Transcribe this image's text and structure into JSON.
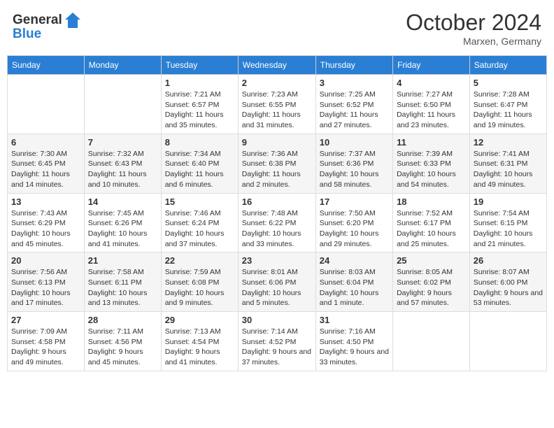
{
  "header": {
    "logo_line1": "General",
    "logo_line2": "Blue",
    "month": "October 2024",
    "location": "Marxen, Germany"
  },
  "weekdays": [
    "Sunday",
    "Monday",
    "Tuesday",
    "Wednesday",
    "Thursday",
    "Friday",
    "Saturday"
  ],
  "weeks": [
    [
      {
        "day": "",
        "sunrise": "",
        "sunset": "",
        "daylight": ""
      },
      {
        "day": "",
        "sunrise": "",
        "sunset": "",
        "daylight": ""
      },
      {
        "day": "1",
        "sunrise": "Sunrise: 7:21 AM",
        "sunset": "Sunset: 6:57 PM",
        "daylight": "Daylight: 11 hours and 35 minutes."
      },
      {
        "day": "2",
        "sunrise": "Sunrise: 7:23 AM",
        "sunset": "Sunset: 6:55 PM",
        "daylight": "Daylight: 11 hours and 31 minutes."
      },
      {
        "day": "3",
        "sunrise": "Sunrise: 7:25 AM",
        "sunset": "Sunset: 6:52 PM",
        "daylight": "Daylight: 11 hours and 27 minutes."
      },
      {
        "day": "4",
        "sunrise": "Sunrise: 7:27 AM",
        "sunset": "Sunset: 6:50 PM",
        "daylight": "Daylight: 11 hours and 23 minutes."
      },
      {
        "day": "5",
        "sunrise": "Sunrise: 7:28 AM",
        "sunset": "Sunset: 6:47 PM",
        "daylight": "Daylight: 11 hours and 19 minutes."
      }
    ],
    [
      {
        "day": "6",
        "sunrise": "Sunrise: 7:30 AM",
        "sunset": "Sunset: 6:45 PM",
        "daylight": "Daylight: 11 hours and 14 minutes."
      },
      {
        "day": "7",
        "sunrise": "Sunrise: 7:32 AM",
        "sunset": "Sunset: 6:43 PM",
        "daylight": "Daylight: 11 hours and 10 minutes."
      },
      {
        "day": "8",
        "sunrise": "Sunrise: 7:34 AM",
        "sunset": "Sunset: 6:40 PM",
        "daylight": "Daylight: 11 hours and 6 minutes."
      },
      {
        "day": "9",
        "sunrise": "Sunrise: 7:36 AM",
        "sunset": "Sunset: 6:38 PM",
        "daylight": "Daylight: 11 hours and 2 minutes."
      },
      {
        "day": "10",
        "sunrise": "Sunrise: 7:37 AM",
        "sunset": "Sunset: 6:36 PM",
        "daylight": "Daylight: 10 hours and 58 minutes."
      },
      {
        "day": "11",
        "sunrise": "Sunrise: 7:39 AM",
        "sunset": "Sunset: 6:33 PM",
        "daylight": "Daylight: 10 hours and 54 minutes."
      },
      {
        "day": "12",
        "sunrise": "Sunrise: 7:41 AM",
        "sunset": "Sunset: 6:31 PM",
        "daylight": "Daylight: 10 hours and 49 minutes."
      }
    ],
    [
      {
        "day": "13",
        "sunrise": "Sunrise: 7:43 AM",
        "sunset": "Sunset: 6:29 PM",
        "daylight": "Daylight: 10 hours and 45 minutes."
      },
      {
        "day": "14",
        "sunrise": "Sunrise: 7:45 AM",
        "sunset": "Sunset: 6:26 PM",
        "daylight": "Daylight: 10 hours and 41 minutes."
      },
      {
        "day": "15",
        "sunrise": "Sunrise: 7:46 AM",
        "sunset": "Sunset: 6:24 PM",
        "daylight": "Daylight: 10 hours and 37 minutes."
      },
      {
        "day": "16",
        "sunrise": "Sunrise: 7:48 AM",
        "sunset": "Sunset: 6:22 PM",
        "daylight": "Daylight: 10 hours and 33 minutes."
      },
      {
        "day": "17",
        "sunrise": "Sunrise: 7:50 AM",
        "sunset": "Sunset: 6:20 PM",
        "daylight": "Daylight: 10 hours and 29 minutes."
      },
      {
        "day": "18",
        "sunrise": "Sunrise: 7:52 AM",
        "sunset": "Sunset: 6:17 PM",
        "daylight": "Daylight: 10 hours and 25 minutes."
      },
      {
        "day": "19",
        "sunrise": "Sunrise: 7:54 AM",
        "sunset": "Sunset: 6:15 PM",
        "daylight": "Daylight: 10 hours and 21 minutes."
      }
    ],
    [
      {
        "day": "20",
        "sunrise": "Sunrise: 7:56 AM",
        "sunset": "Sunset: 6:13 PM",
        "daylight": "Daylight: 10 hours and 17 minutes."
      },
      {
        "day": "21",
        "sunrise": "Sunrise: 7:58 AM",
        "sunset": "Sunset: 6:11 PM",
        "daylight": "Daylight: 10 hours and 13 minutes."
      },
      {
        "day": "22",
        "sunrise": "Sunrise: 7:59 AM",
        "sunset": "Sunset: 6:08 PM",
        "daylight": "Daylight: 10 hours and 9 minutes."
      },
      {
        "day": "23",
        "sunrise": "Sunrise: 8:01 AM",
        "sunset": "Sunset: 6:06 PM",
        "daylight": "Daylight: 10 hours and 5 minutes."
      },
      {
        "day": "24",
        "sunrise": "Sunrise: 8:03 AM",
        "sunset": "Sunset: 6:04 PM",
        "daylight": "Daylight: 10 hours and 1 minute."
      },
      {
        "day": "25",
        "sunrise": "Sunrise: 8:05 AM",
        "sunset": "Sunset: 6:02 PM",
        "daylight": "Daylight: 9 hours and 57 minutes."
      },
      {
        "day": "26",
        "sunrise": "Sunrise: 8:07 AM",
        "sunset": "Sunset: 6:00 PM",
        "daylight": "Daylight: 9 hours and 53 minutes."
      }
    ],
    [
      {
        "day": "27",
        "sunrise": "Sunrise: 7:09 AM",
        "sunset": "Sunset: 4:58 PM",
        "daylight": "Daylight: 9 hours and 49 minutes."
      },
      {
        "day": "28",
        "sunrise": "Sunrise: 7:11 AM",
        "sunset": "Sunset: 4:56 PM",
        "daylight": "Daylight: 9 hours and 45 minutes."
      },
      {
        "day": "29",
        "sunrise": "Sunrise: 7:13 AM",
        "sunset": "Sunset: 4:54 PM",
        "daylight": "Daylight: 9 hours and 41 minutes."
      },
      {
        "day": "30",
        "sunrise": "Sunrise: 7:14 AM",
        "sunset": "Sunset: 4:52 PM",
        "daylight": "Daylight: 9 hours and 37 minutes."
      },
      {
        "day": "31",
        "sunrise": "Sunrise: 7:16 AM",
        "sunset": "Sunset: 4:50 PM",
        "daylight": "Daylight: 9 hours and 33 minutes."
      },
      {
        "day": "",
        "sunrise": "",
        "sunset": "",
        "daylight": ""
      },
      {
        "day": "",
        "sunrise": "",
        "sunset": "",
        "daylight": ""
      }
    ]
  ]
}
